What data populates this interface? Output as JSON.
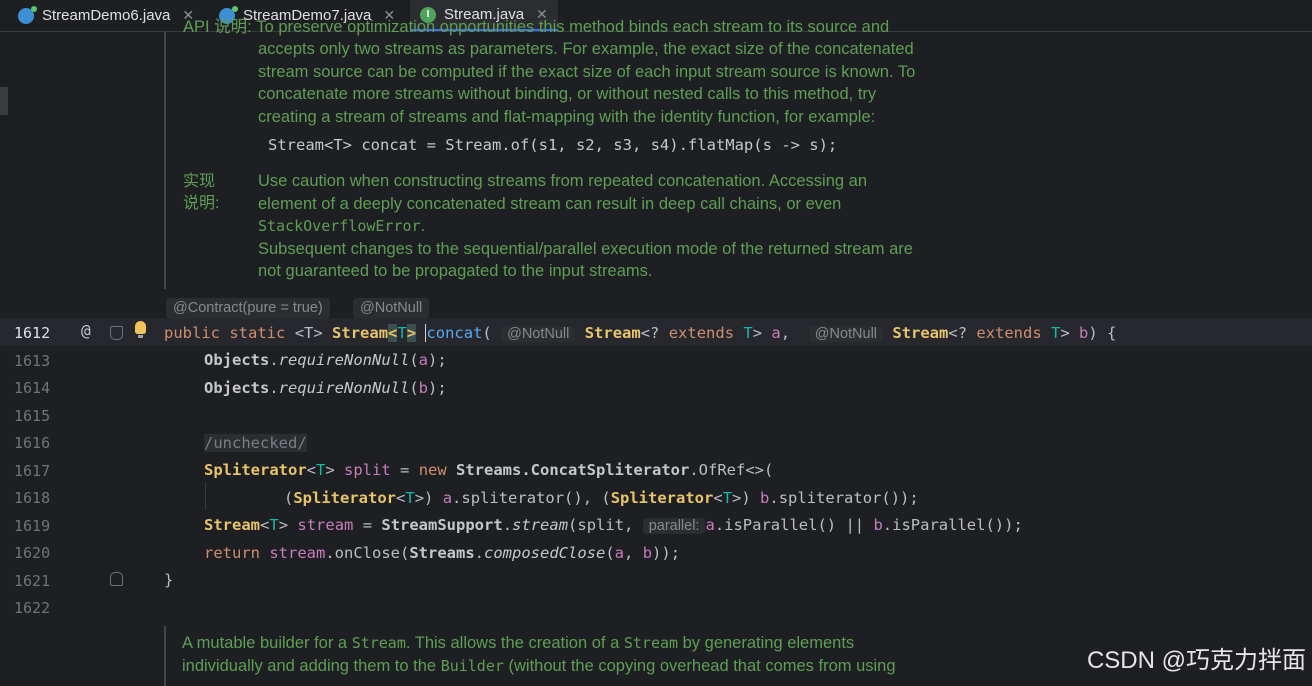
{
  "tabs": [
    {
      "label": "StreamDemo6.java",
      "icon": "java-class-icon",
      "active": false
    },
    {
      "label": "StreamDemo7.java",
      "icon": "java-class-icon",
      "active": false
    },
    {
      "label": "Stream.java",
      "icon": "java-interface-icon",
      "active": true
    }
  ],
  "tab_close": "✕",
  "icon_letters": {
    "interface": "I"
  },
  "doc_top": {
    "cut_line": "API 说明: To preserve optimization opportunities this method binds each stream to its source and",
    "lines": [
      "accepts only two streams as parameters. For example, the exact size of the concatenated",
      "stream source can be computed if the exact size of each input stream source is known. To",
      "concatenate more streams without binding, or without nested calls to this method, try",
      "creating a stream of streams and flat-mapping with the identity function, for example:"
    ],
    "code_example": "Stream<T> concat = Stream.of(s1, s2, s3, s4).flatMap(s -> s);",
    "impl_label_1": "实现",
    "impl_label_2": "说明:",
    "impl_line_1": "Use caution when constructing streams from repeated concatenation. Accessing an",
    "impl_line_2": "element of a deeply concatenated stream can result in deep call chains, or even",
    "impl_line_3_code": "StackOverflowError",
    "impl_line_3_suffix": ".",
    "impl_line_4": "Subsequent changes to the sequential/parallel execution mode of the returned stream are",
    "impl_line_5": "not guaranteed to be propagated to the input streams."
  },
  "inlays": {
    "contract": "@Contract(pure = true)",
    "notnull": "@NotNull",
    "param_notnull": "@NotNull",
    "parallel": "parallel:"
  },
  "gutter": {
    "line_numbers": [
      "1612",
      "1613",
      "1614",
      "1615",
      "1616",
      "1617",
      "1618",
      "1619",
      "1620",
      "1621",
      "1622"
    ],
    "at_symbol": "@"
  },
  "code": {
    "l1612": {
      "kw1": "public",
      "kw2": "static",
      "tp_open": "<T>",
      "ret": "Stream",
      "ret_gen_l": "<",
      "ret_gen_t": "T",
      "ret_gen_r": ">",
      "name": "concat",
      "p_open": "(",
      "p1_type": "Stream",
      "p1_gen": "<? ",
      "p1_ext": "extends",
      "p1_t": "T",
      "p1_close": "> ",
      "p1_name": "a",
      "comma": ", ",
      "p2_type": "Stream",
      "p2_gen": "<? ",
      "p2_ext": "extends",
      "p2_t": "T",
      "p2_close": "> ",
      "p2_name": "b",
      "tail": ") {"
    },
    "l1613": {
      "cls": "Objects",
      "dot": ".",
      "m": "requireNonNull",
      "open": "(",
      "arg": "a",
      "close": ");"
    },
    "l1614": {
      "cls": "Objects",
      "dot": ".",
      "m": "requireNonNull",
      "open": "(",
      "arg": "b",
      "close": ");"
    },
    "l1616": {
      "comment": "/unchecked/"
    },
    "l1617": {
      "type": "Spliterator",
      "gen_l": "<",
      "gen_t": "T",
      "gen_r": ">",
      "var": " split",
      "eq": " = ",
      "kw": "new",
      "cls": " Streams.ConcatSpliterator",
      "rest": ".OfRef<>("
    },
    "l1618": {
      "open": "(",
      "type1": "Spliterator",
      "g1l": "<",
      "g1t": "T",
      "g1r": ">",
      "c1": ") ",
      "a": "a",
      "m1": ".spliterator(), (",
      "type2": "Spliterator",
      "g2l": "<",
      "g2t": "T",
      "g2r": ">",
      "c2": ") ",
      "b": "b",
      "m2": ".spliterator());"
    },
    "l1619": {
      "type": "Stream",
      "gen_l": "<",
      "gen_t": "T",
      "gen_r": ">",
      "var": " stream",
      "eq": " = ",
      "cls": "StreamSupport",
      "dot": ".",
      "m": "stream",
      "args": "(split, ",
      "a": "a",
      "m2": ".isParallel() || ",
      "b": "b",
      "m3": ".isParallel());"
    },
    "l1620": {
      "kw": "return",
      "var": " stream",
      "m": ".onClose(",
      "cls": "Streams",
      "dot": ".",
      "m2": "composedClose",
      "args_open": "(",
      "a": "a",
      "comma": ", ",
      "b": "b",
      "close": "));"
    },
    "l1621": {
      "brace": "}"
    }
  },
  "doc_bottom": {
    "l1_a": "A mutable builder for a ",
    "l1_code1": "Stream",
    "l1_b": ". This allows the creation of a ",
    "l1_code2": "Stream",
    "l1_c": " by generating elements",
    "l2_a": "individually and adding them to the ",
    "l2_code": "Builder",
    "l2_b": " (without the copying overhead that comes from using"
  },
  "watermark": "CSDN @巧克力拌面"
}
